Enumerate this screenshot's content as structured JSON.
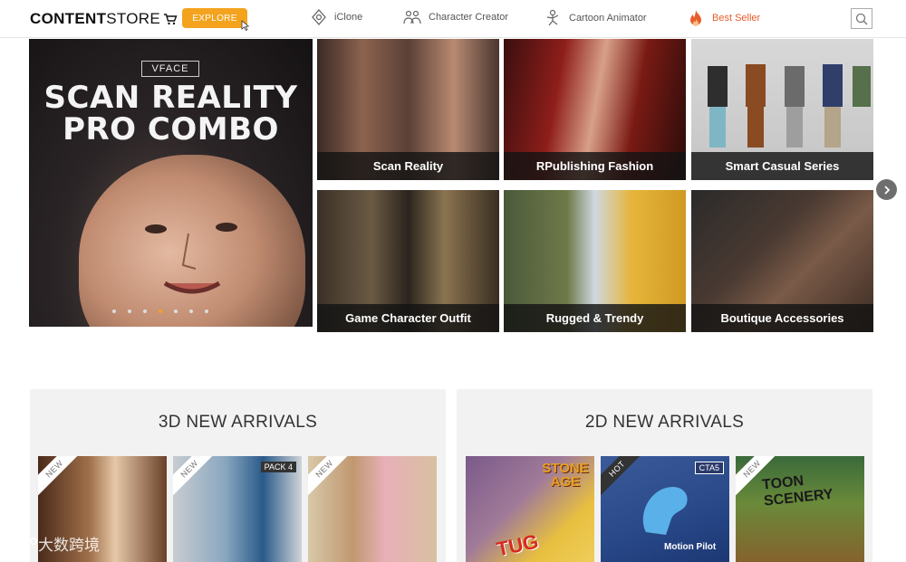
{
  "header": {
    "logo_bold": "CONTENT",
    "logo_thin": "STORE",
    "explore_label": "EXPLORE",
    "nav": [
      {
        "label": "iClone",
        "icon": "iclone-icon"
      },
      {
        "label": "Character Creator",
        "icon": "character-creator-icon"
      },
      {
        "label": "Cartoon Animator",
        "icon": "cartoon-animator-icon"
      },
      {
        "label": "Best Seller",
        "icon": "flame-icon"
      }
    ],
    "accent_color": "#f4a31e",
    "best_seller_color": "#e85d2a"
  },
  "hero": {
    "brand": "VFACE",
    "title_line1": "SCAN REALITY",
    "title_line2": "PRO COMBO",
    "slide_count": 7,
    "active_slide": 4
  },
  "tiles": [
    {
      "label": "Scan Reality"
    },
    {
      "label": "RPublishing Fashion"
    },
    {
      "label": "Smart Casual Series"
    },
    {
      "label": "Game Character Outfit"
    },
    {
      "label": "Rugged & Trendy"
    },
    {
      "label": "Boutique Accessories"
    }
  ],
  "arrivals_3d": {
    "title": "3D NEW ARRIVALS",
    "items": [
      {
        "ribbon": "NEW",
        "badge": ""
      },
      {
        "ribbon": "NEW",
        "badge": "PACK 4"
      },
      {
        "ribbon": "NEW",
        "badge": ""
      }
    ]
  },
  "arrivals_2d": {
    "title": "2D NEW ARRIVALS",
    "items": [
      {
        "ribbon": "",
        "badge": "",
        "text1": "STONE AGE",
        "text2": "TUG"
      },
      {
        "ribbon": "HOT",
        "badge": "CTA5",
        "text1": "Motion Pilot"
      },
      {
        "ribbon": "NEW",
        "badge": "",
        "text1": "TOON SCENERY"
      }
    ]
  },
  "watermark": "大数跨境"
}
